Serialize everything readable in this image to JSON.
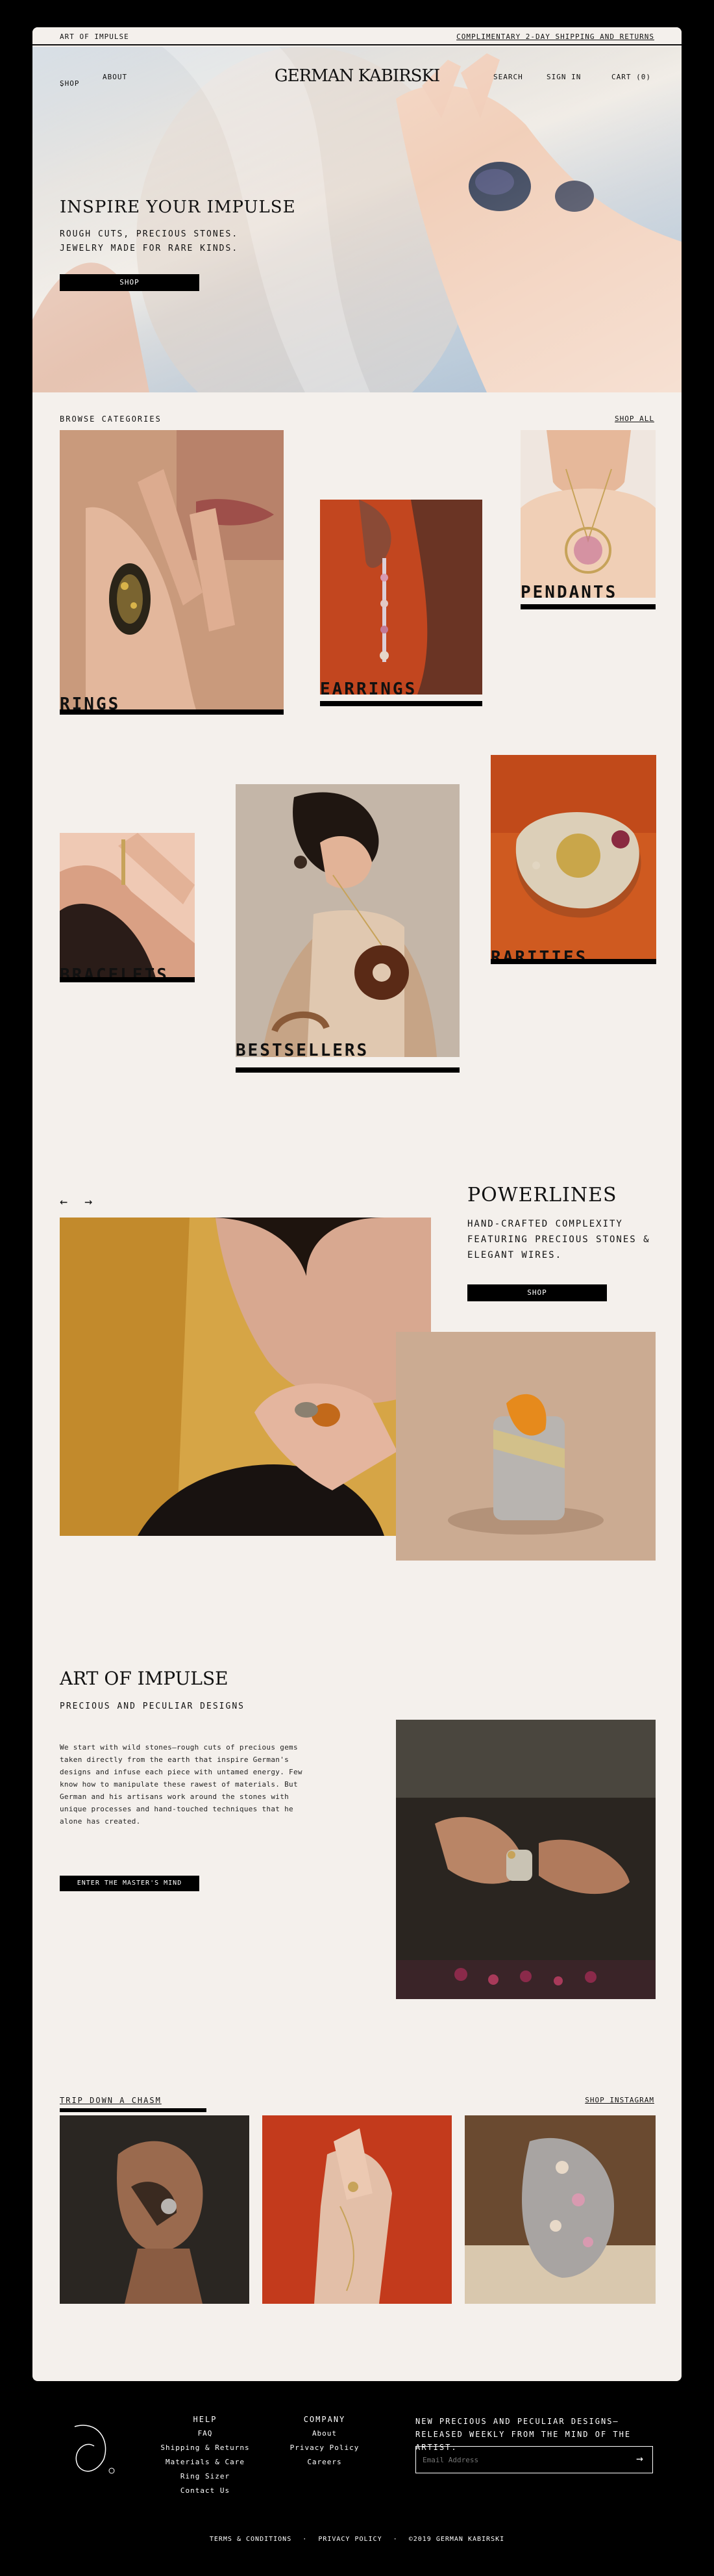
{
  "announcement": {
    "left": "ART OF IMPULSE",
    "right": "COMPLIMENTARY 2-DAY SHIPPING AND RETURNS"
  },
  "nav": {
    "shop": "SHOP",
    "about": "ABOUT",
    "logo": "GERMAN KABIRSKI",
    "search": "SEARCH",
    "sign_in": "SIGN IN",
    "cart": "CART (0)"
  },
  "hero": {
    "title": "INSPIRE YOUR IMPULSE",
    "subtitle": "ROUGH CUTS, PRECIOUS STONES. JEWELRY MADE FOR RARE KINDS.",
    "button": "SHOP"
  },
  "categories": {
    "heading": "BROWSE CATEGORIES",
    "shop_all": "SHOP ALL",
    "items": [
      {
        "label": "RINGS"
      },
      {
        "label": "EARRINGS"
      },
      {
        "label": "PENDANTS"
      },
      {
        "label": "BRACELETS"
      },
      {
        "label": "BESTSELLERS"
      },
      {
        "label": "RARITIES"
      }
    ]
  },
  "powerlines": {
    "title": "POWERLINES",
    "text": "HAND-CRAFTED COMPLEXITY FEATURING PRECIOUS STONES & ELEGANT WIRES.",
    "button": "SHOP",
    "prev": "←",
    "next": "→"
  },
  "art": {
    "title": "ART OF IMPULSE",
    "subtitle": "PRECIOUS AND PECULIAR DESIGNS",
    "body": "We start with wild stones—rough cuts of precious gems taken directly from the earth that inspire German's designs and infuse each piece with untamed energy. Few know how to manipulate these rawest of materials. But German and his artisans work around the stones with unique processes and hand-touched techniques that he alone has created.",
    "button": "ENTER THE MASTER'S MIND"
  },
  "instagram": {
    "heading": "TRIP DOWN A CHASM",
    "link": "SHOP INSTAGRAM"
  },
  "footer": {
    "help": {
      "title": "HELP",
      "items": [
        "FAQ",
        "Shipping & Returns",
        "Materials & Care",
        "Ring Sizer",
        "Contact Us"
      ]
    },
    "company": {
      "title": "COMPANY",
      "items": [
        "About",
        "Privacy Policy",
        "Careers"
      ]
    },
    "newsletter": {
      "text": "NEW PRECIOUS AND PECULIAR DESIGNS—RELEASED WEEKLY FROM THE MIND OF THE ARTIST.",
      "placeholder": "Email Address"
    },
    "legal": [
      "TERMS & CONDITIONS",
      "PRIVACY POLICY",
      "©2019 GERMAN KABIRSKI"
    ],
    "separator": "·"
  },
  "colors": {
    "background": "#f4f0ec",
    "ink": "#000000",
    "accent_orange": "#c9561f"
  }
}
